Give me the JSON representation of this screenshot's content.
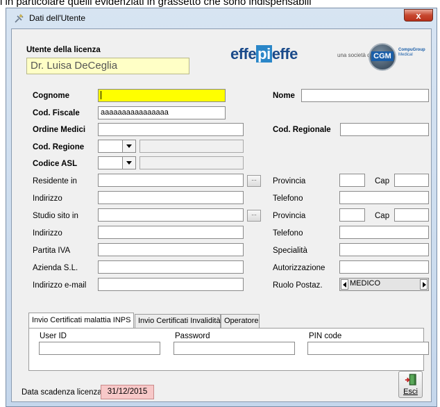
{
  "background_text": "i in particolare quelli evidenziati in grassetto che sono indispensabili",
  "window": {
    "title": "Dati dell'Utente",
    "close_label": "x"
  },
  "license": {
    "header": "Utente della licenza",
    "user_name": "Dr. Luisa DeCeglia",
    "expiry_label": "Data scadenza licenza:",
    "expiry_value": "31/12/2015"
  },
  "branding": {
    "logo_left": "effe",
    "logo_mid": "pi",
    "logo_right": "effe",
    "company_note": "una società di",
    "cgm": "CGM",
    "cgm_sub1": "CompuGroup",
    "cgm_sub2": "Medical"
  },
  "form": {
    "cognome_label": "Cognome",
    "cognome_value": "",
    "nome_label": "Nome",
    "nome_value": "",
    "codfiscale_label": "Cod. Fiscale",
    "codfiscale_value": "aaaaaaaaaaaaaaaa",
    "ordine_label": "Ordine Medici",
    "ordine_value": "",
    "codregionale_label": "Cod. Regionale",
    "codregionale_value": "",
    "codregione_label": "Cod. Regione",
    "codiceasl_label": "Codice ASL",
    "residente_label": "Residente in",
    "provincia1_label": "Provincia",
    "cap1_label": "Cap",
    "indirizzo1_label": "Indirizzo",
    "telefono1_label": "Telefono",
    "studio_label": "Studio sito in",
    "provincia2_label": "Provincia",
    "cap2_label": "Cap",
    "indirizzo2_label": "Indirizzo",
    "telefono2_label": "Telefono",
    "partitaiva_label": "Partita IVA",
    "specialita_label": "Specialità",
    "azienda_label": "Azienda S.L.",
    "autorizzazione_label": "Autorizzazione",
    "email_label": "Indirizzo e-mail",
    "ruolo_label": "Ruolo Postaz.",
    "ruolo_value": "MEDICO",
    "dots_label": "..."
  },
  "tabs": [
    {
      "label": "Invio Certificati malattia INPS"
    },
    {
      "label": "Invio Certificati Invalidità"
    },
    {
      "label": "Operatore"
    }
  ],
  "tab_fields": {
    "userid_label": "User ID",
    "password_label": "Password",
    "pin_label": "PIN code"
  },
  "exit_button": {
    "label": "Esci"
  },
  "colors": {
    "highlight_input": "#ffff00",
    "name_box": "#ffffc6",
    "expiry_box": "#f7c8c8"
  }
}
